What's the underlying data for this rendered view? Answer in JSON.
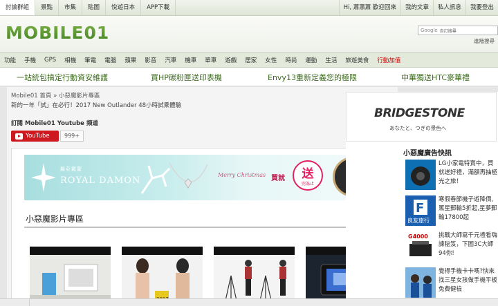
{
  "top_tabs": [
    "討論群組",
    "景點",
    "市集",
    "貼圖",
    "悅遊日本",
    "APP下載"
  ],
  "top_right": {
    "greeting": "Hi, 蕭蕭蕭 歡迎回來",
    "my_articles": "我的文章",
    "private_messages": "私人訊息",
    "logout": "我要登出"
  },
  "logo": {
    "text": "MOBILE01"
  },
  "search": {
    "brand": "Google",
    "placeholder": "自訂搜尋",
    "advanced": "進階搜尋"
  },
  "categories": [
    "功能",
    "手機",
    "GPS",
    "相機",
    "筆電",
    "電腦",
    "蘋果",
    "影音",
    "汽車",
    "機車",
    "單車",
    "遊戲",
    "居家",
    "女性",
    "時尚",
    "運動",
    "生活",
    "旅遊美食",
    "行動加值"
  ],
  "promos": [
    "一站統包搞定行動資安維護",
    "買HP碳粉匣送印表機",
    "Envy13重新定義您的極限",
    "中華獨送HTC豪華禮"
  ],
  "breadcrumb": "Mobile01 首頁 » 小惡魔影片專區",
  "subtitle": "新的一年「試」在必行！2017 New Outlander 48小時試乘體驗",
  "subscribe": {
    "label": "訂閱 Mobile01 Youtube 頻道",
    "button": "YouTube",
    "count": "999+"
  },
  "banner": {
    "brand_cn": "羅亞戴蒙",
    "brand_en": "ROYAL DAMON",
    "merry": "Merry Christmas",
    "buy": "買就",
    "give": "送",
    "give_sub": "完為止",
    "ad_choice": "▷ ✕"
  },
  "section_title": "小惡魔影片專區",
  "thumb_badge": "2017",
  "right_ad": {
    "brand": "BRIDGESTONE",
    "tagline": "あなたと、つぎの景色へ"
  },
  "side_title": "小惡魔廣告快訊",
  "side_items": [
    {
      "text": "LG小家電特賣中，買就送好禮，滿額再抽極光之旅！"
    },
    {
      "text": "寒假春節機子遊降價,罵星郵輪5折起,星夢郵輪17800起",
      "badge": "良友旅行"
    },
    {
      "text": "挑戰大師寫千元禮看嗨諫秘笈，下圖3C大師94你!",
      "label": "G4000"
    },
    {
      "text": "覺得手機卡卡嗎?快來找三星女孩做手機平板免費健檢"
    }
  ]
}
